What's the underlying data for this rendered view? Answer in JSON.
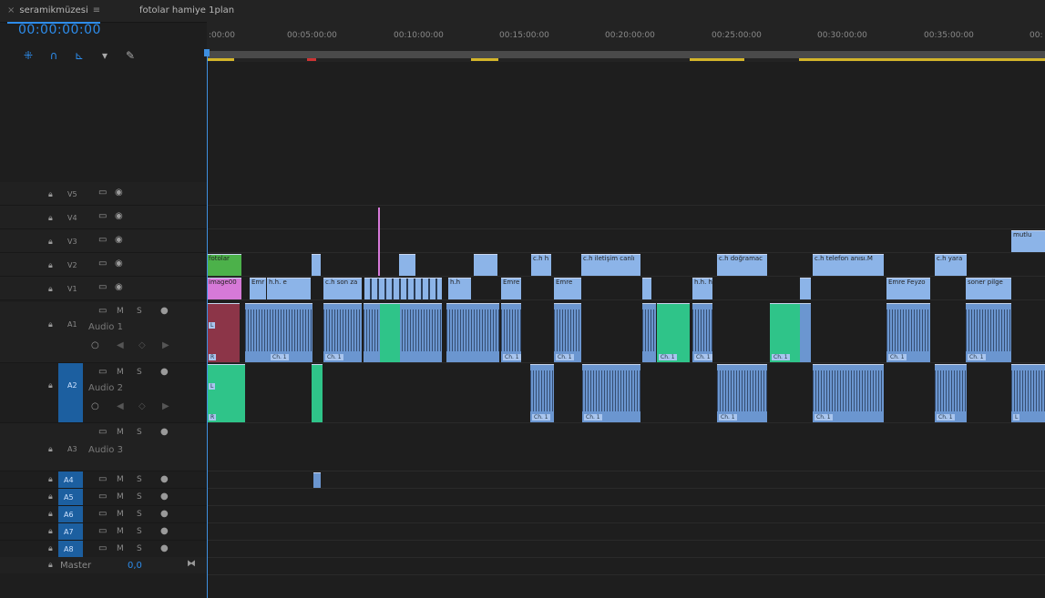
{
  "tabs": [
    {
      "label": "seramikmüzesi",
      "close": "×",
      "menu": "≡"
    },
    {
      "label": "fotolar hamiye 1plan"
    }
  ],
  "timecode": "00:00:00:00",
  "tools": [
    "ripple-icon",
    "magnet-icon",
    "marker-add-icon",
    "marker-icon",
    "wrench-icon"
  ],
  "ruler_labels": [
    ":00:00",
    "00:05:00:00",
    "00:10:00:00",
    "00:15:00:00",
    "00:20:00:00",
    "00:25:00:00",
    "00:30:00:00",
    "00:35:00:00",
    "00:"
  ],
  "video_tracks": [
    "V5",
    "V4",
    "V3",
    "V2",
    "V1"
  ],
  "audio_tracks": [
    {
      "id": "A1",
      "name": "Audio 1",
      "m": "M",
      "s": "S"
    },
    {
      "id": "A2",
      "name": "Audio 2",
      "m": "M",
      "s": "S"
    },
    {
      "id": "A3",
      "name": "Audio 3",
      "m": "M",
      "s": "S"
    },
    {
      "id": "A4",
      "m": "M",
      "s": "S"
    },
    {
      "id": "A5",
      "m": "M",
      "s": "S"
    },
    {
      "id": "A6",
      "m": "M",
      "s": "S"
    },
    {
      "id": "A7",
      "m": "M",
      "s": "S"
    },
    {
      "id": "A8",
      "m": "M",
      "s": "S"
    }
  ],
  "master": {
    "label": "Master",
    "value": "0,0"
  },
  "v3_clips": [
    "mutlu"
  ],
  "v2_clips": [
    "fotolar",
    "c.h h",
    "c.h iletişim canlı",
    "c.h doğramac",
    "c.h telefon anısı.M",
    "c.h yara"
  ],
  "v1_clips": [
    "image00",
    "Emr",
    "h.h. e",
    "c.h son za",
    "h.h",
    "Emre",
    "Emre",
    "h.h. h",
    "Emre Feyzo",
    "soner pilge"
  ],
  "audio_channel_label": "Ch. 1",
  "clip_markers": {
    "L": "L",
    "R": "R"
  },
  "colors": {
    "accent": "#2d8ceb",
    "video_clip": "#8cb4e8",
    "audio_clip": "#6b96d0",
    "green_clip": "#2fc489",
    "pink_clip": "#d679d8"
  }
}
